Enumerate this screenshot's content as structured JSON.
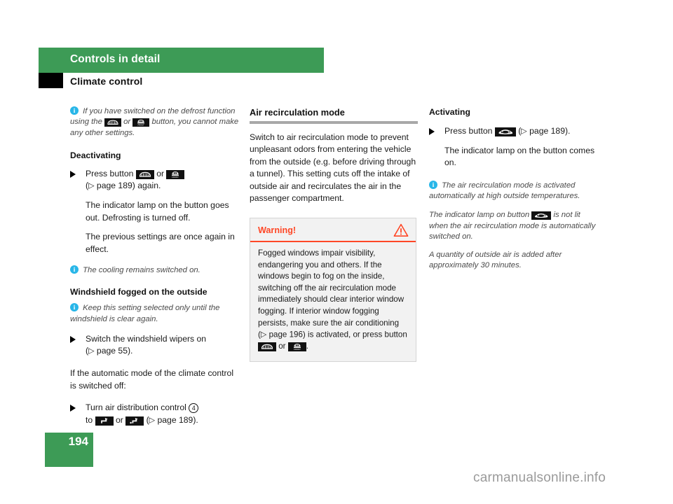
{
  "header": {
    "chapter_title": "Controls in detail",
    "section_title": "Climate control"
  },
  "left_column": {
    "note_defrost": "If you have switched on the defrost function using the  or  button, you cannot make any other settings.",
    "note_defrost_part1": "If you have switched on the defrost function using the",
    "note_defrost_or": "or",
    "note_defrost_part2": "button, you cannot make any other settings.",
    "heading_deactivating": "Deactivating",
    "step_press_button": "Press button",
    "step_press_or": "or",
    "step_press_ref": "( page 189) again.",
    "step_press_ref_text": "page 189) again.",
    "para_indicator": "The indicator lamp on the button goes out. Defrosting is turned off.",
    "para_previous": "The previous settings are once again in effect.",
    "note_cooling": "The cooling remains switched on.",
    "heading_windshield": "Windshield fogged on the outside",
    "note_keep_setting": "Keep this setting selected only until the windshield is clear again.",
    "step_wipers": "Switch the windshield wipers on",
    "step_wipers_ref": "page 55).",
    "para_auto_mode": "If the automatic mode of the climate control is switched off:",
    "step_turn_control": "Turn air distribution control",
    "step_turn_marker": "4",
    "step_turn_to": "to",
    "step_turn_or": "or",
    "step_turn_ref": "page 189)."
  },
  "middle_column": {
    "heading": "Air recirculation mode",
    "body": "Switch to air recirculation mode to prevent unpleasant odors from entering the vehicle from the outside (e.g. before driving through a tunnel). This setting cuts off the intake of outside air and recirculates the air in the passenger compartment.",
    "warning": {
      "label": "Warning!",
      "text_part1": "Fogged windows impair visibility, endangering you and others. If the windows begin to fog on the inside, switching off the air recirculation mode immediately should clear interior window fogging. If interior window fogging persists, make sure the air conditioning (",
      "ref": "page 196) is activated, or press button",
      "text_or": "or",
      "text_end": "."
    }
  },
  "right_column": {
    "heading_activating": "Activating",
    "step_press_button": "Press button",
    "step_press_ref": "page 189).",
    "para_indicator": "The indicator lamp on the button comes on.",
    "note_auto": "The air recirculation mode is activated automatically at high outside temperatures.",
    "note_indicator_part1": "The indicator lamp on button",
    "note_indicator_part2": "is not lit when the air recirculation mode is automatically switched on.",
    "note_quantity": "A quantity of outside air is added after approximately 30 minutes."
  },
  "footer": {
    "page_number": "194",
    "watermark": "carmanualsonline.info"
  },
  "icons": {
    "rear_defrost": "rear-defrost-icon",
    "front_defrost": "front-defrost-icon",
    "front_defrost_label": "FRONT",
    "air_recirculation": "air-recirculation-icon",
    "air_dist_windshield": "air-distribution-windshield-icon",
    "air_dist_footwell": "air-distribution-footwell-icon",
    "info": "info-icon",
    "warning_triangle": "warning-triangle-icon",
    "ref_arrow": "▷"
  },
  "colors": {
    "chapter_green": "#3d9b56",
    "warning_red": "#ff4726",
    "info_blue": "#28b6e8",
    "rule_gray": "#a8a8a8"
  }
}
